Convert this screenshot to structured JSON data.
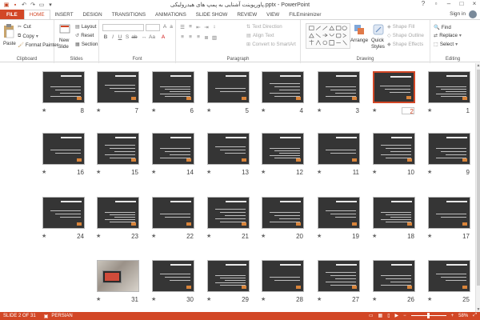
{
  "app": {
    "title": "پاورپوینت آشنایی به پمپ های هیدرولیکی.pptx - PowerPoint",
    "sign_in": "Sign in"
  },
  "tabs": [
    {
      "label": "FILE"
    },
    {
      "label": "HOME"
    },
    {
      "label": "INSERT"
    },
    {
      "label": "DESIGN"
    },
    {
      "label": "TRANSITIONS"
    },
    {
      "label": "ANIMATIONS"
    },
    {
      "label": "SLIDE SHOW"
    },
    {
      "label": "REVIEW"
    },
    {
      "label": "VIEW"
    },
    {
      "label": "FILEminimizer"
    }
  ],
  "ribbon": {
    "clipboard": {
      "label": "Clipboard",
      "paste": "Paste",
      "cut": "Cut",
      "copy": "Copy",
      "format_painter": "Format Painter"
    },
    "slides": {
      "label": "Slides",
      "new_slide_1": "New",
      "new_slide_2": "Slide",
      "layout": "Layout",
      "reset": "Reset",
      "section": "Section"
    },
    "font": {
      "label": "Font"
    },
    "paragraph": {
      "label": "Paragraph",
      "text_direction": "Text Direction",
      "align_text": "Align Text",
      "convert": "Convert to SmartArt"
    },
    "drawing": {
      "label": "Drawing",
      "arrange": "Arrange",
      "quick_styles_1": "Quick",
      "quick_styles_2": "Styles",
      "shape_fill": "Shape Fill",
      "shape_outline": "Shape Outline",
      "shape_effects": "Shape Effects"
    },
    "editing": {
      "label": "Editing",
      "find": "Find",
      "replace": "Replace",
      "select": "Select"
    }
  },
  "slides": {
    "rows": [
      {
        "numbers": [
          "8",
          "7",
          "6",
          "5",
          "4",
          "3",
          "2",
          "1"
        ]
      },
      {
        "numbers": [
          "16",
          "15",
          "14",
          "13",
          "12",
          "11",
          "10",
          "9"
        ]
      },
      {
        "numbers": [
          "24",
          "23",
          "22",
          "21",
          "20",
          "19",
          "18",
          "17"
        ]
      },
      {
        "numbers": [
          "",
          "31",
          "30",
          "29",
          "28",
          "27",
          "26",
          "25"
        ]
      }
    ],
    "selected": "2"
  },
  "status": {
    "slide": "SLIDE 2 OF 31",
    "language": "PERSIAN",
    "zoom": "58%"
  },
  "colors": {
    "accent": "#d24726",
    "thumb_bg": "#353535"
  }
}
